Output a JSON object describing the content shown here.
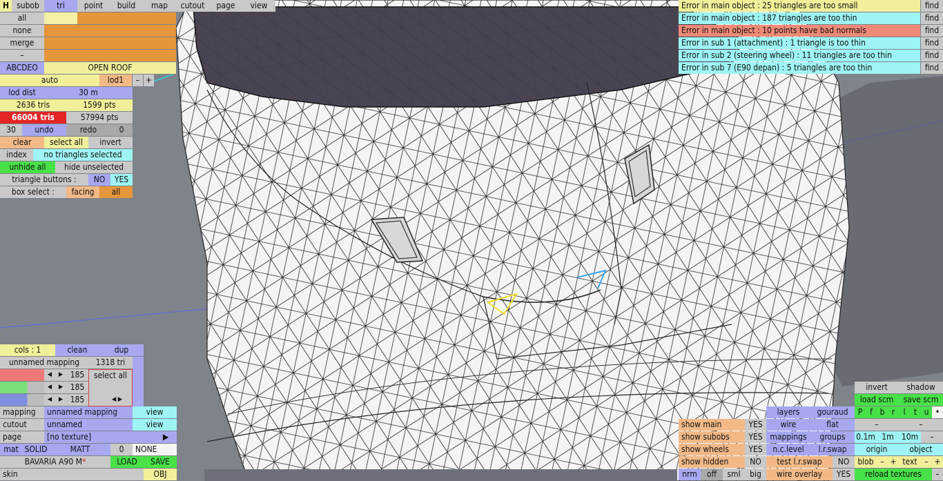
{
  "toolbar": {
    "h": "H",
    "subob": "subob",
    "tri": "tri",
    "point": "point",
    "build": "build",
    "map": "map",
    "cutout": "cutout",
    "page": "page",
    "view": "view"
  },
  "left": {
    "all": "all",
    "none": "none",
    "merge": "merge",
    "minus": "–",
    "abcdeo": "ABCDEO",
    "open_roof": "OPEN ROOF",
    "auto": "auto",
    "lod1": "lod1",
    "lod_minus": "–",
    "lod_plus": "+",
    "lod_dist": "lod dist",
    "lod_dist_val": "30 m",
    "tris": "2636 tris",
    "pts": "1599 pts",
    "total_tris": "66004 tris",
    "total_pts": "57994 pts",
    "undo_count": "30",
    "undo": "undo",
    "redo": "redo",
    "redo_count": "0",
    "clear": "clear",
    "select_all": "select all",
    "invert": "invert",
    "index": "index",
    "no_tri": "no triangles selected",
    "unhide_all": "unhide all",
    "hide_unselected": "hide unselected",
    "triangle_buttons": "triangle buttons :",
    "no": "NO",
    "yes": "YES",
    "box_select": "box select :",
    "facing": "facing",
    "box_all": "all"
  },
  "mapping": {
    "cols": "cols : 1",
    "clean": "clean",
    "dup": "dup",
    "unnamed_mapping": "unnamed mapping",
    "tri_count": "1318 tri",
    "v1": "185",
    "v2": "185",
    "v3": "185",
    "select_all": "select all",
    "mapping": "mapping",
    "mapping_name": "unnamed mapping",
    "view": "view",
    "cutout": "cutout",
    "cutout_name": "unnamed",
    "view2": "view",
    "page": "page",
    "texture": "[no texture]",
    "play": "▶",
    "mat": "mat",
    "solid": "SOLID",
    "matt": "MATT",
    "zero": "0",
    "none": "NONE",
    "car_name": "BAVARIA A90 M",
    "asterisk": "*",
    "load": "LOAD",
    "save": "SAVE",
    "skin": "skin",
    "obj": "OBJ"
  },
  "errors": [
    {
      "text": "Error in main object : 25 triangles are too small",
      "find": "find",
      "color": "#f2ef9a"
    },
    {
      "text": "Error in main object : 187 triangles are too thin",
      "find": "find",
      "color": "#9ef4f4"
    },
    {
      "text": "Error in main object : 10 points have bad normals",
      "find": "find",
      "color": "#f08a78"
    },
    {
      "text": "Error in sub 1 (attachment) : 1 triangle is too thin",
      "find": "find",
      "color": "#9ef4f4"
    },
    {
      "text": "Error in sub 2 (steering wheel) : 11 triangles are too thin",
      "find": "find",
      "color": "#9ef4f4"
    },
    {
      "text": "Error in sub 7 (E90 depan) : 5 triangles are too thin",
      "find": "find",
      "color": "#9ef4f4"
    }
  ],
  "view_panel": {
    "invert": "invert",
    "shadow": "shadow",
    "load_scm": "load scm",
    "save_scm": "save scm",
    "flags": [
      "P",
      "f",
      "b",
      "r",
      "l",
      "t",
      "u",
      "•"
    ],
    "layers": "layers",
    "gouraud": "gouraud",
    "wire": "wire",
    "flat": "flat",
    "mappings": "mappings",
    "groups": "groups",
    "n_c_level": "n.c.level",
    "l_r_swap": "l.r.swap",
    "test_lr_swap": "test l.r.swap",
    "no": "NO",
    "wire_overlay": "wire overlay",
    "yes": "YES",
    "show_main": "show main",
    "show_subobs": "show subobs",
    "show_wheels": "show wheels",
    "show_hidden": "show hidden",
    "yes1": "YES",
    "yes2": "YES",
    "yes3": "YES",
    "no1": "NO",
    "minus1": "–",
    "minus2": "–",
    "d01": "0.1m",
    "d1": "1m",
    "d10": "10m",
    "dminus": "–",
    "origin": "origin",
    "object": "object",
    "blob": "blob",
    "bminus": "–",
    "bplus": "+",
    "text": "text",
    "tminus": "–",
    "tplus": "+",
    "reload": "reload textures",
    "rminus": "–",
    "nrm": "nrm",
    "off": "off",
    "sml": "sml",
    "big": "big"
  }
}
